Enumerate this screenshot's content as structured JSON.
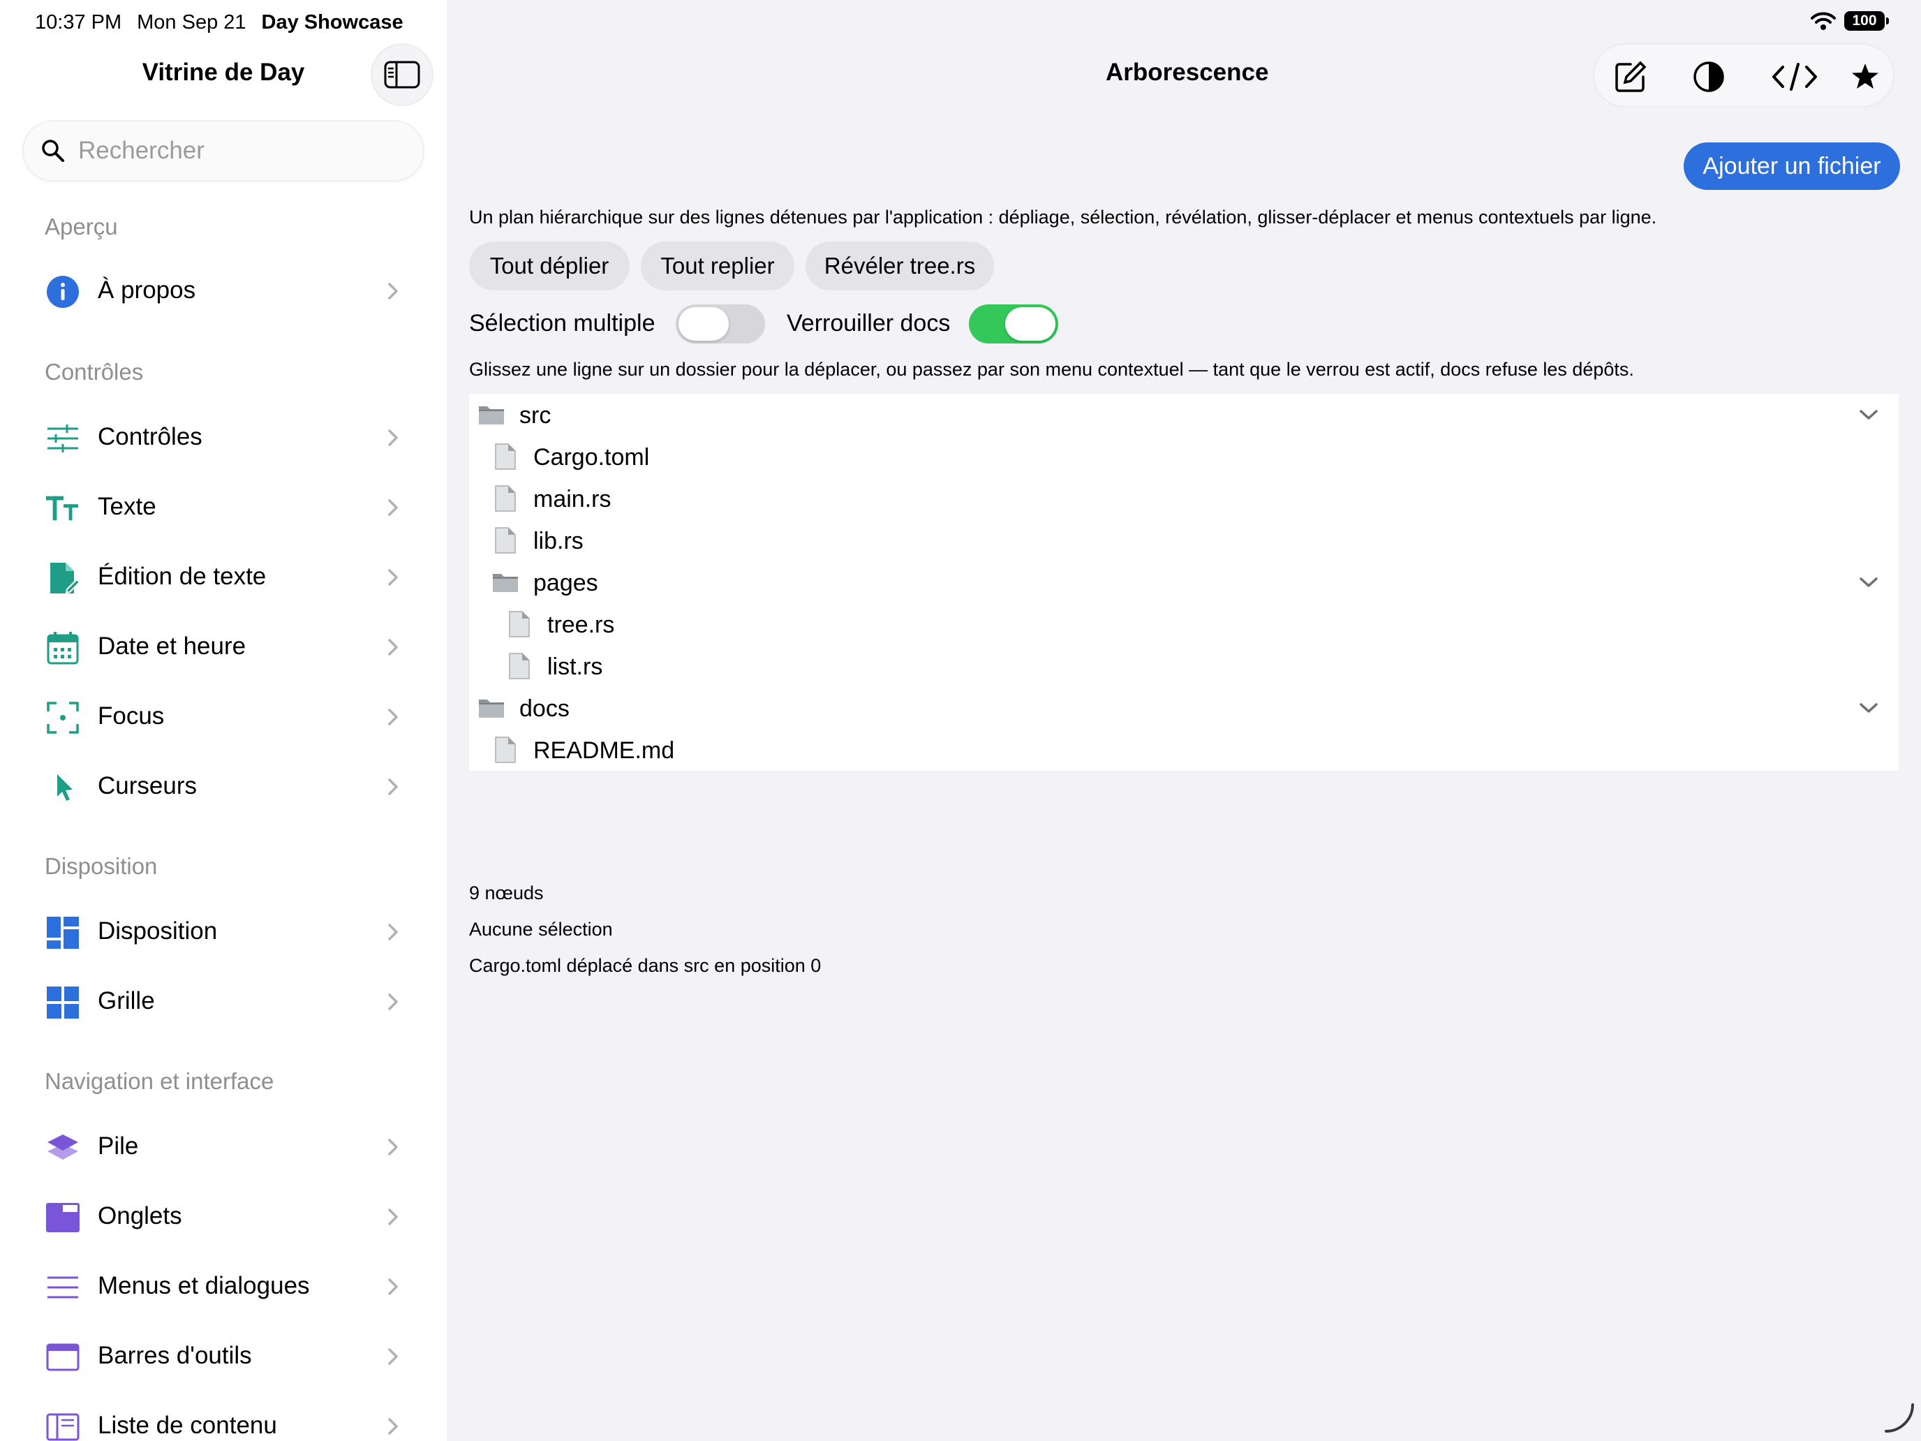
{
  "status_bar": {
    "time": "10:37 PM",
    "date": "Mon Sep 21",
    "app": "Day Showcase",
    "battery": "100"
  },
  "sidebar": {
    "title": "Vitrine de Day",
    "search_placeholder": "Rechercher",
    "sections": [
      {
        "title": "Aperçu",
        "items": [
          {
            "label": "À propos",
            "icon": "info-icon"
          }
        ]
      },
      {
        "title": "Contrôles",
        "items": [
          {
            "label": "Contrôles",
            "icon": "sliders-icon"
          },
          {
            "label": "Texte",
            "icon": "text-size-icon"
          },
          {
            "label": "Édition de texte",
            "icon": "document-edit-icon"
          },
          {
            "label": "Date et heure",
            "icon": "calendar-icon"
          },
          {
            "label": "Focus",
            "icon": "focus-icon"
          },
          {
            "label": "Curseurs",
            "icon": "cursor-icon"
          }
        ]
      },
      {
        "title": "Disposition",
        "items": [
          {
            "label": "Disposition",
            "icon": "layout-icon"
          },
          {
            "label": "Grille",
            "icon": "grid-icon"
          }
        ]
      },
      {
        "title": "Navigation et interface",
        "items": [
          {
            "label": "Pile",
            "icon": "stack-icon"
          },
          {
            "label": "Onglets",
            "icon": "tabs-icon"
          },
          {
            "label": "Menus et dialogues",
            "icon": "menu-lines-icon"
          },
          {
            "label": "Barres d'outils",
            "icon": "toolbar-icon"
          },
          {
            "label": "Liste de contenu",
            "icon": "split-list-icon"
          }
        ]
      }
    ]
  },
  "main": {
    "title": "Arborescence",
    "toolbar_icons": [
      "compose-icon",
      "contrast-icon",
      "code-icon",
      "star-icon"
    ],
    "add_button": "Ajouter un fichier",
    "description": "Un plan hiérarchique sur des lignes détenues par l'application : dépliage, sélection, révélation, glisser-déplacer et menus contextuels par ligne.",
    "actions": [
      "Tout déplier",
      "Tout replier",
      "Révéler tree.rs"
    ],
    "toggles": [
      {
        "label": "Sélection multiple",
        "on": false
      },
      {
        "label": "Verrouiller docs",
        "on": true
      }
    ],
    "hint": "Glissez une ligne sur un dossier pour la déplacer, ou passez par son menu contextuel — tant que le verrou est actif, docs refuse les dépôts.",
    "tree": [
      {
        "name": "src",
        "kind": "folder",
        "depth": 0,
        "expanded": true
      },
      {
        "name": "Cargo.toml",
        "kind": "file",
        "depth": 1
      },
      {
        "name": "main.rs",
        "kind": "file",
        "depth": 1
      },
      {
        "name": "lib.rs",
        "kind": "file",
        "depth": 1
      },
      {
        "name": "pages",
        "kind": "folder",
        "depth": 1,
        "expanded": true
      },
      {
        "name": "tree.rs",
        "kind": "file",
        "depth": 2
      },
      {
        "name": "list.rs",
        "kind": "file",
        "depth": 2
      },
      {
        "name": "docs",
        "kind": "folder",
        "depth": 0,
        "expanded": true
      },
      {
        "name": "README.md",
        "kind": "file",
        "depth": 1
      }
    ],
    "status_lines": [
      "9 nœuds",
      "Aucune sélection",
      "Cargo.toml déplacé dans src en position 0"
    ]
  },
  "colors": {
    "accent": "#2d6fdc",
    "teal": "#1e9e86",
    "blue": "#2d6fdc",
    "purple": "#7a55d8",
    "switch_on": "#34c759"
  }
}
